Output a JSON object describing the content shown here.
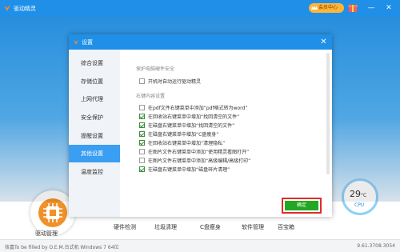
{
  "app": {
    "title": "驱动精灵",
    "vip_label": "会员中心",
    "window_controls": [
      "—",
      "✕"
    ]
  },
  "home": {
    "driver_manage_label": "驱动管理",
    "tools": [
      "硬件检测",
      "垃圾清理",
      "C盘瘦身",
      "软件管理",
      "百宝箱"
    ],
    "temperature": "29",
    "temperature_unit": "°C",
    "cpu_label": "CPU"
  },
  "statusbar": {
    "left": "技嘉To be filled by O.E.M.台式机    Windows 7 64位",
    "version": "9.61.3708.3054"
  },
  "dialog": {
    "title": "设置",
    "nav": [
      "综合设置",
      "存储位置",
      "上网代理",
      "安全保护",
      "提醒设置",
      "其他设置",
      "温度监控"
    ],
    "active_nav_index": 5,
    "sections": {
      "protect_title": "保护电脑硬件安全",
      "protect_option": "开机时自动运行驱动精灵",
      "context_title": "右键内容设置"
    },
    "context_options": [
      {
        "label": "在pdf文件右键菜单中添加“pdf格式转为word”",
        "checked": false
      },
      {
        "label": "在回收站右键菜单中增加“找回清空的文件”",
        "checked": true
      },
      {
        "label": "在磁盘右键菜单中增加“找回清空的文件”",
        "checked": true
      },
      {
        "label": "在磁盘右键菜单中增加“C盘瘦身”",
        "checked": true
      },
      {
        "label": "在回收站右键菜单中增加“清理隐私”",
        "checked": true
      },
      {
        "label": "在图片文件右键菜单中添加“使用精灵看图打开”",
        "checked": false
      },
      {
        "label": "在图片文件右键菜单中添加“高级编辑/高级打印”",
        "checked": false
      },
      {
        "label": "在磁盘右键菜单中增加“磁盘碎片清理”",
        "checked": true
      }
    ],
    "ok_label": "确定"
  },
  "colors": {
    "accent": "#1f8fe8",
    "ok_button": "#22a722",
    "highlight_border": "#e02b2b",
    "active_nav": "#3a9ef2"
  }
}
